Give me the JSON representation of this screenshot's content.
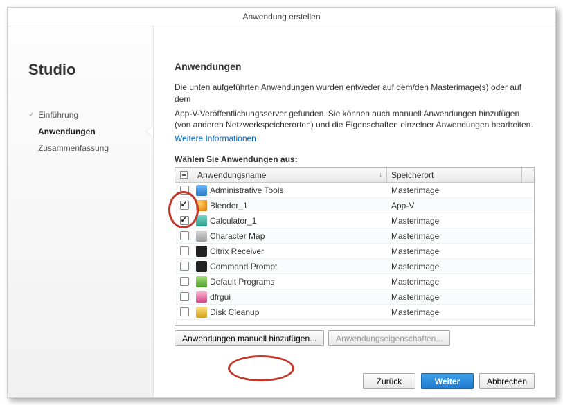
{
  "window": {
    "title": "Anwendung erstellen"
  },
  "sidebar": {
    "heading": "Studio",
    "steps": [
      {
        "label": "Einführung",
        "state": "completed"
      },
      {
        "label": "Anwendungen",
        "state": "current"
      },
      {
        "label": "Zusammenfassung",
        "state": "upcoming"
      }
    ]
  },
  "main": {
    "heading": "Anwendungen",
    "description1": "Die unten aufgeführten Anwendungen wurden entweder auf dem/den Masterimage(s) oder auf dem",
    "description2": "App-V-Veröffentlichungsserver gefunden. Sie können auch manuell Anwendungen hinzufügen (von anderen Netzwerkspeicherorten) und die Eigenschaften einzelner Anwendungen bearbeiten.",
    "infolink": "Weitere Informationen",
    "tablelabel": "Wählen Sie Anwendungen aus:",
    "columns": {
      "name": "Anwendungsname",
      "location": "Speicherort"
    },
    "rows": [
      {
        "checked": false,
        "icon": "ic-blue",
        "name": "Administrative Tools",
        "location": "Masterimage"
      },
      {
        "checked": true,
        "icon": "ic-orange",
        "name": "Blender_1",
        "location": "App-V"
      },
      {
        "checked": true,
        "icon": "ic-teal",
        "name": "Calculator_1",
        "location": "Masterimage"
      },
      {
        "checked": false,
        "icon": "ic-gray",
        "name": "Character Map",
        "location": "Masterimage"
      },
      {
        "checked": false,
        "icon": "ic-black",
        "name": "Citrix Receiver",
        "location": "Masterimage"
      },
      {
        "checked": false,
        "icon": "ic-black",
        "name": "Command Prompt",
        "location": "Masterimage"
      },
      {
        "checked": false,
        "icon": "ic-green",
        "name": "Default Programs",
        "location": "Masterimage"
      },
      {
        "checked": false,
        "icon": "ic-pink",
        "name": "dfrgui",
        "location": "Masterimage"
      },
      {
        "checked": false,
        "icon": "ic-yellow",
        "name": "Disk Cleanup",
        "location": "Masterimage"
      }
    ],
    "addbtn": "Anwendungen manuell hinzufügen...",
    "propsbtn": "Anwendungseigenschaften..."
  },
  "footer": {
    "back": "Zurück",
    "next": "Weiter",
    "cancel": "Abbrechen"
  }
}
